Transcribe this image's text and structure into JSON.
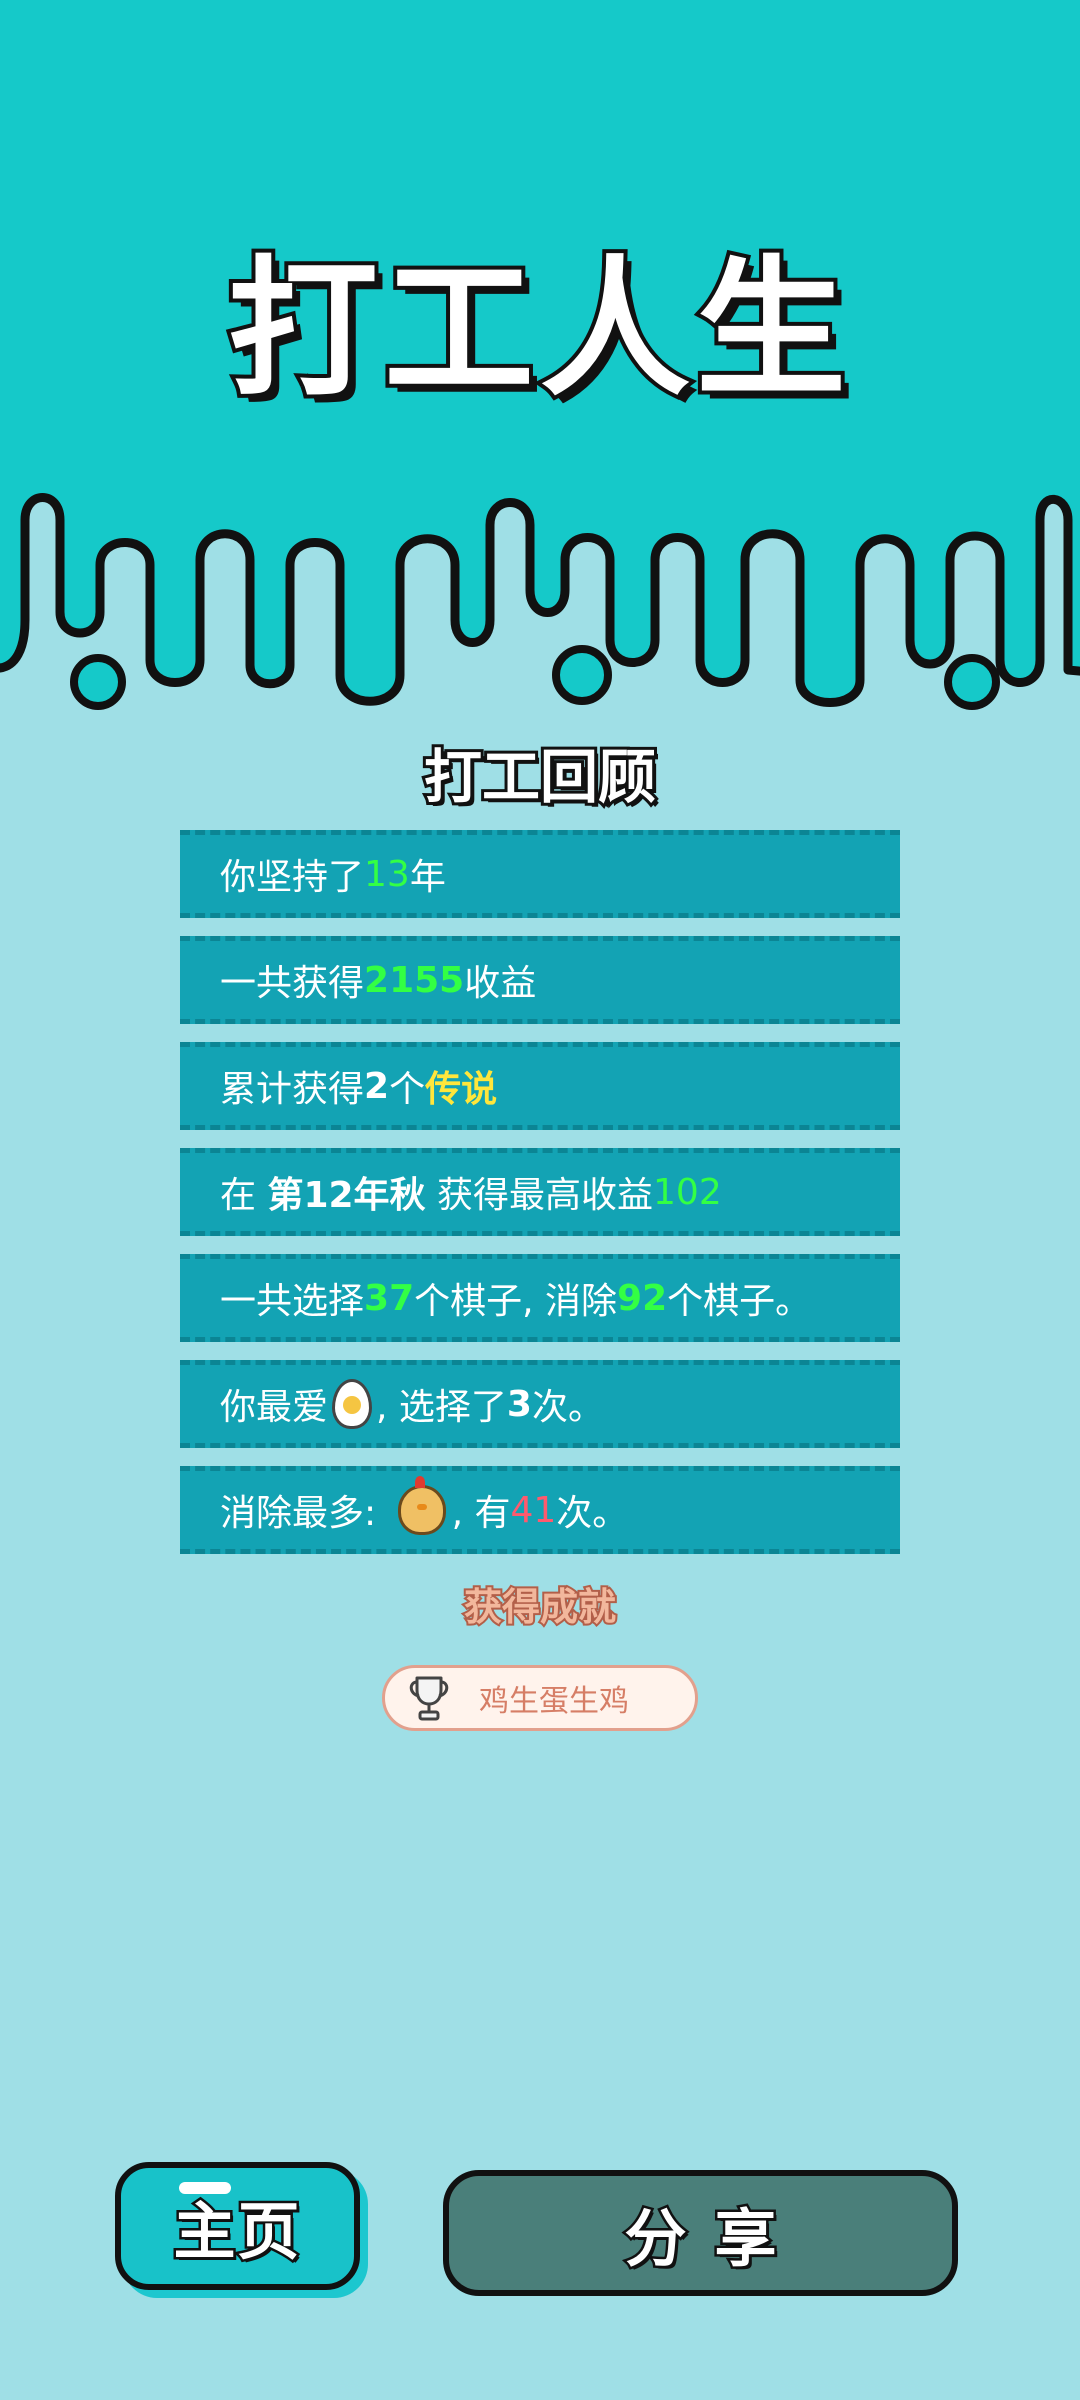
{
  "app": {
    "title": "打工人生",
    "subtitle": "打工回顾"
  },
  "stats": [
    {
      "pre": "你坚持了",
      "num": "13",
      "post": "年"
    },
    {
      "pre": "一共获得",
      "num": "2155",
      "post": "收益"
    },
    {
      "pre": "累计获得",
      "count": "2",
      "mid": "个",
      "rarity": "传说"
    },
    {
      "pre": "在 ",
      "season": "第12年秋",
      "mid": " 获得最高收益",
      "num": "102"
    },
    {
      "pre": "一共选择",
      "chosen": "37",
      "mid": "个棋子, 消除",
      "removed": "92",
      "post": "个棋子。"
    },
    {
      "pre": "你最爱",
      "icon": "egg-icon",
      "mid": ", 选择了",
      "times": "3",
      "post": "次。"
    },
    {
      "pre": "消除最多: ",
      "icon": "chick-icon",
      "mid": ", 有",
      "times": "41",
      "post": "次。"
    }
  ],
  "achievements": {
    "title": "获得成就",
    "items": [
      {
        "icon": "trophy-icon",
        "label": "鸡生蛋生鸡"
      }
    ]
  },
  "buttons": {
    "home": "主页",
    "share": "分享"
  },
  "colors": {
    "top_band": "#15c9c9",
    "background": "#9fdfe6",
    "row": "#13a3b4",
    "highlight_green": "#33ff44",
    "highlight_yellow": "#ffe63b",
    "highlight_red": "#ff5a6e",
    "share_button": "#4a7f7a"
  }
}
